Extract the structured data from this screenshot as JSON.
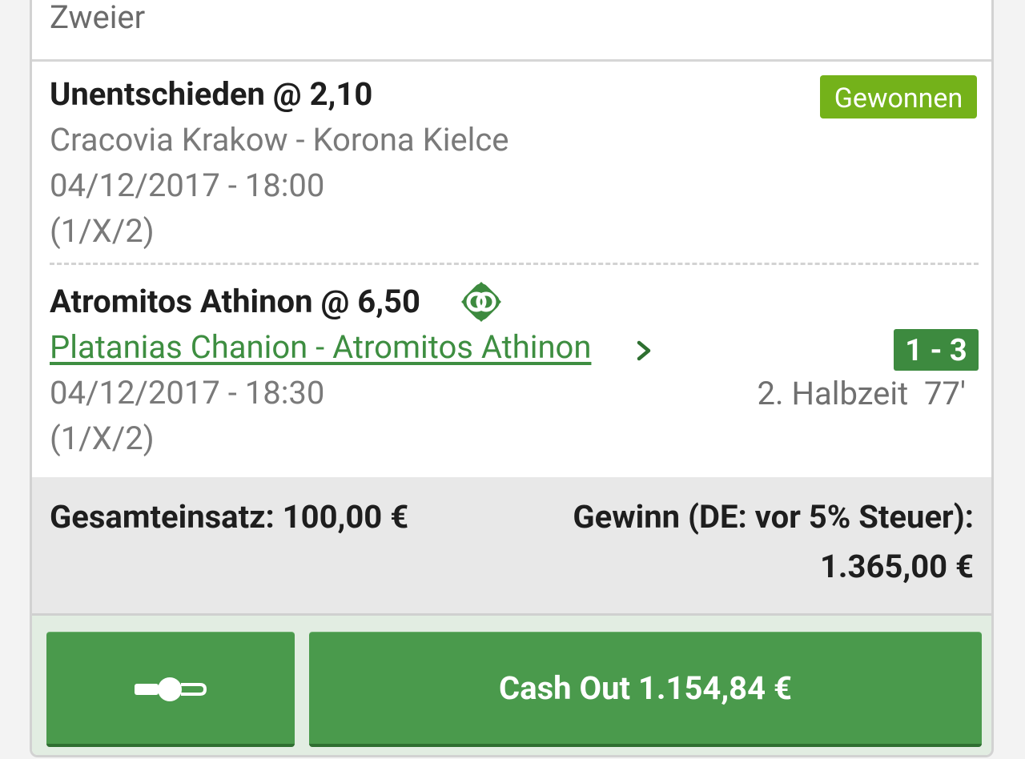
{
  "bet_type": "Zweier",
  "selections": [
    {
      "title": "Unentschieden @ 2,10",
      "match": "Cracovia Krakow - Korona Kielce",
      "datetime": "04/12/2017 - 18:00",
      "market": "(1/X/2)",
      "status": "Gewonnen"
    },
    {
      "title": "Atromitos Athinon @ 6,50",
      "match": "Platanias Chanion - Atromitos Athinon",
      "datetime": "04/12/2017 - 18:30",
      "market": "(1/X/2)",
      "score": "1 - 3",
      "period": "2. Halbzeit  77'",
      "cashout_icon": "cash-out-icon"
    }
  ],
  "totals": {
    "stake": "Gesamteinsatz: 100,00 €",
    "win_label": "Gewinn (DE: vor 5% Steuer):",
    "win_value": "1.365,00 €"
  },
  "actions": {
    "toggle_icon": "toggle-icon",
    "cashout_label": "Cash Out 1.154,84 €"
  },
  "colors": {
    "accent_green": "#4a9a4c",
    "won_badge": "#74b21a",
    "link_green": "#3e8e41"
  }
}
